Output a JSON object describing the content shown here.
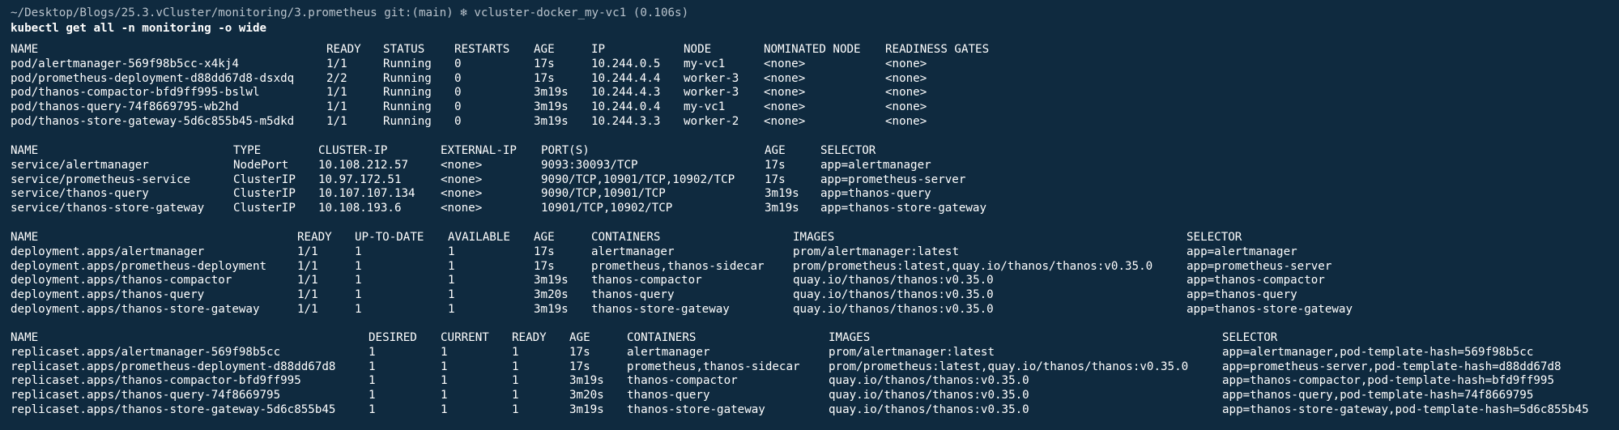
{
  "prompt": {
    "path": "~/Desktop/Blogs/25.3.vCluster/monitoring/3.prometheus",
    "git": "git:(main)",
    "k8s_icon": "❄",
    "context": "vcluster-docker_my-vc1 (0.106s)"
  },
  "command": "kubectl get all -n monitoring -o wide",
  "pods": {
    "headers": [
      "NAME",
      "READY",
      "STATUS",
      "RESTARTS",
      "AGE",
      "IP",
      "NODE",
      "NOMINATED NODE",
      "READINESS GATES"
    ],
    "rows": [
      [
        "pod/alertmanager-569f98b5cc-x4kj4",
        "1/1",
        "Running",
        "0",
        "17s",
        "10.244.0.5",
        "my-vc1",
        "<none>",
        "<none>"
      ],
      [
        "pod/prometheus-deployment-d88dd67d8-dsxdq",
        "2/2",
        "Running",
        "0",
        "17s",
        "10.244.4.4",
        "worker-3",
        "<none>",
        "<none>"
      ],
      [
        "pod/thanos-compactor-bfd9ff995-bslwl",
        "1/1",
        "Running",
        "0",
        "3m19s",
        "10.244.4.3",
        "worker-3",
        "<none>",
        "<none>"
      ],
      [
        "pod/thanos-query-74f8669795-wb2hd",
        "1/1",
        "Running",
        "0",
        "3m19s",
        "10.244.0.4",
        "my-vc1",
        "<none>",
        "<none>"
      ],
      [
        "pod/thanos-store-gateway-5d6c855b45-m5dkd",
        "1/1",
        "Running",
        "0",
        "3m19s",
        "10.244.3.3",
        "worker-2",
        "<none>",
        "<none>"
      ]
    ]
  },
  "services": {
    "headers": [
      "NAME",
      "TYPE",
      "CLUSTER-IP",
      "EXTERNAL-IP",
      "PORT(S)",
      "AGE",
      "SELECTOR"
    ],
    "rows": [
      [
        "service/alertmanager",
        "NodePort",
        "10.108.212.57",
        "<none>",
        "9093:30093/TCP",
        "17s",
        "app=alertmanager"
      ],
      [
        "service/prometheus-service",
        "ClusterIP",
        "10.97.172.51",
        "<none>",
        "9090/TCP,10901/TCP,10902/TCP",
        "17s",
        "app=prometheus-server"
      ],
      [
        "service/thanos-query",
        "ClusterIP",
        "10.107.107.134",
        "<none>",
        "9090/TCP,10901/TCP",
        "3m19s",
        "app=thanos-query"
      ],
      [
        "service/thanos-store-gateway",
        "ClusterIP",
        "10.108.193.6",
        "<none>",
        "10901/TCP,10902/TCP",
        "3m19s",
        "app=thanos-store-gateway"
      ]
    ]
  },
  "deployments": {
    "headers": [
      "NAME",
      "READY",
      "UP-TO-DATE",
      "AVAILABLE",
      "AGE",
      "CONTAINERS",
      "IMAGES",
      "SELECTOR"
    ],
    "rows": [
      [
        "deployment.apps/alertmanager",
        "1/1",
        "1",
        "1",
        "17s",
        "alertmanager",
        "prom/alertmanager:latest",
        "app=alertmanager"
      ],
      [
        "deployment.apps/prometheus-deployment",
        "1/1",
        "1",
        "1",
        "17s",
        "prometheus,thanos-sidecar",
        "prom/prometheus:latest,quay.io/thanos/thanos:v0.35.0",
        "app=prometheus-server"
      ],
      [
        "deployment.apps/thanos-compactor",
        "1/1",
        "1",
        "1",
        "3m19s",
        "thanos-compactor",
        "quay.io/thanos/thanos:v0.35.0",
        "app=thanos-compactor"
      ],
      [
        "deployment.apps/thanos-query",
        "1/1",
        "1",
        "1",
        "3m20s",
        "thanos-query",
        "quay.io/thanos/thanos:v0.35.0",
        "app=thanos-query"
      ],
      [
        "deployment.apps/thanos-store-gateway",
        "1/1",
        "1",
        "1",
        "3m19s",
        "thanos-store-gateway",
        "quay.io/thanos/thanos:v0.35.0",
        "app=thanos-store-gateway"
      ]
    ]
  },
  "replicasets": {
    "headers": [
      "NAME",
      "DESIRED",
      "CURRENT",
      "READY",
      "AGE",
      "CONTAINERS",
      "IMAGES",
      "SELECTOR"
    ],
    "rows": [
      [
        "replicaset.apps/alertmanager-569f98b5cc",
        "1",
        "1",
        "1",
        "17s",
        "alertmanager",
        "prom/alertmanager:latest",
        "app=alertmanager,pod-template-hash=569f98b5cc"
      ],
      [
        "replicaset.apps/prometheus-deployment-d88dd67d8",
        "1",
        "1",
        "1",
        "17s",
        "prometheus,thanos-sidecar",
        "prom/prometheus:latest,quay.io/thanos/thanos:v0.35.0",
        "app=prometheus-server,pod-template-hash=d88dd67d8"
      ],
      [
        "replicaset.apps/thanos-compactor-bfd9ff995",
        "1",
        "1",
        "1",
        "3m19s",
        "thanos-compactor",
        "quay.io/thanos/thanos:v0.35.0",
        "app=thanos-compactor,pod-template-hash=bfd9ff995"
      ],
      [
        "replicaset.apps/thanos-query-74f8669795",
        "1",
        "1",
        "1",
        "3m20s",
        "thanos-query",
        "quay.io/thanos/thanos:v0.35.0",
        "app=thanos-query,pod-template-hash=74f8669795"
      ],
      [
        "replicaset.apps/thanos-store-gateway-5d6c855b45",
        "1",
        "1",
        "1",
        "3m19s",
        "thanos-store-gateway",
        "quay.io/thanos/thanos:v0.35.0",
        "app=thanos-store-gateway,pod-template-hash=5d6c855b45"
      ]
    ]
  },
  "colors": {
    "background": "#0f2a3f",
    "text": "#ffffff",
    "prompt_text": "#b9c3cc"
  }
}
